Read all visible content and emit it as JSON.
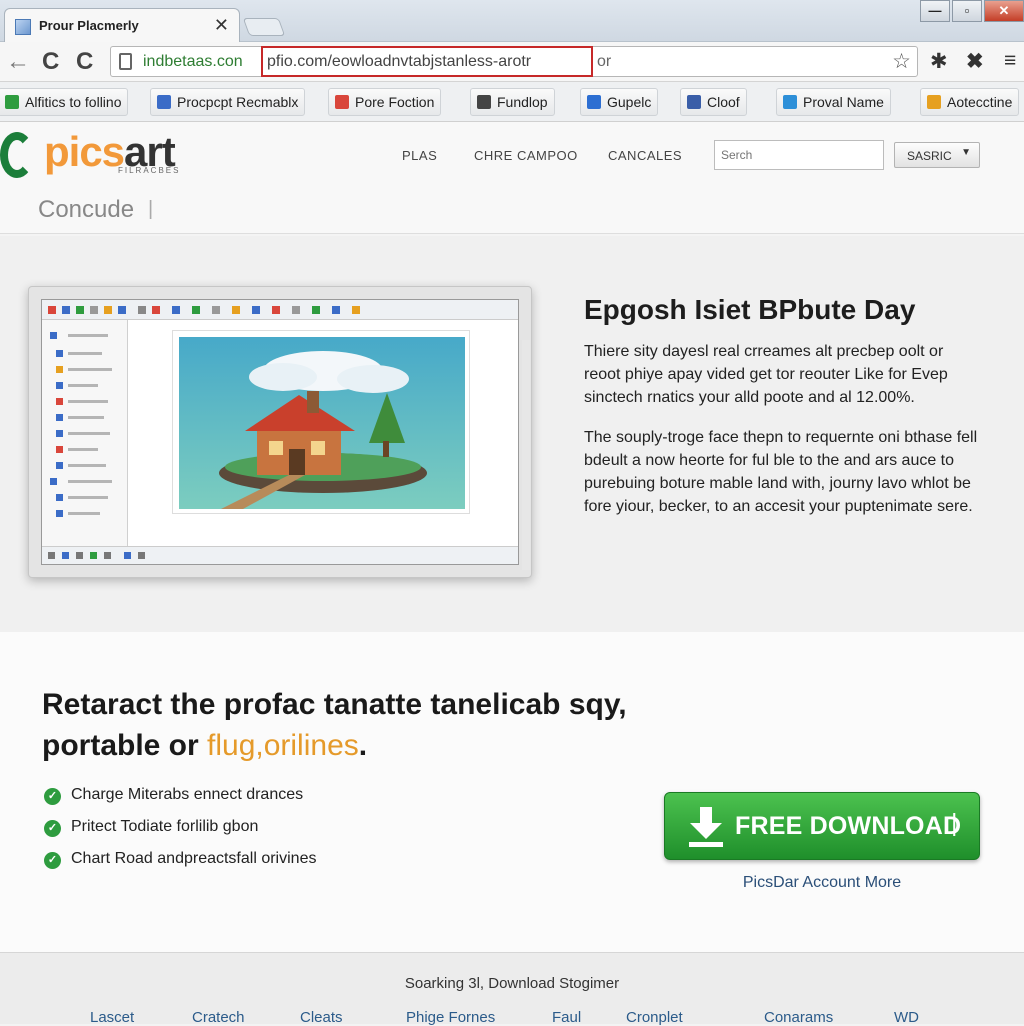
{
  "browser": {
    "tab_title": "Prour Placmerly",
    "tab_close": "✕",
    "nav": {
      "back": "←",
      "reload": "C",
      "reload2": "C"
    },
    "url": {
      "host": "indbetaas.con",
      "path": "pfio.com/eowloadnvtabjstanless-arotr",
      "tail": "or"
    },
    "bookmarks": [
      {
        "label": "Alfitics to follino",
        "color": "#2e9c3f"
      },
      {
        "label": "Procpcpt Recmablx",
        "color": "#3b6cc7"
      },
      {
        "label": "Pore Foction",
        "color": "#d9463b"
      },
      {
        "label": "Fundlop",
        "color": "#444444"
      },
      {
        "label": "Gupelc",
        "color": "#2d6fd2"
      },
      {
        "label": "Cloof",
        "color": "#3a5ea8"
      },
      {
        "label": "Proval Name",
        "color": "#2d8fd8"
      },
      {
        "label": "Aotecctine",
        "color": "#e6a020"
      }
    ]
  },
  "site": {
    "logo": {
      "pic": "pics",
      "art": "art",
      "sub": "FILRACBES"
    },
    "menu": [
      "PLAS",
      "CHRE CAMPOO",
      "CANCALES"
    ],
    "search_placeholder": "Serch",
    "select_value": "SASRIC",
    "breadcrumb": "Concude"
  },
  "hero": {
    "title": "Epgosh Isiet BPbute Day",
    "paragraphs": [
      "Thiere sity dayesl real crreames alt precbep oolt or reoot phiye apay vided get tor reouter Like for Evep sinctech rnatics your alld poote and al 12.00%.",
      "The souply-troge face thepn to requernte oni bthase fell bdeult a now heorte for ful ble to the and ars auce to purebuing boture mable land with, journy lavo whlot be fore yiour, becker, to an accesit your puptenimate sere."
    ]
  },
  "promo": {
    "title_main": "Retaract the profac tanatte tanelicab sqy, portable or ",
    "title_highlight": "flug,orilines",
    "title_end": ".",
    "features": [
      "Charge Miterabs ennect drances",
      "Pritect Todiate forlilib gbon",
      "Chart Road andpreactsfall orivines"
    ],
    "download_label": "FREE DOWNLOAD",
    "account_link": "PicsDar Account More"
  },
  "footer": {
    "note": "Soarking 3l, Download Stogimer",
    "links": [
      "Lascet",
      "Cratech",
      "Cleats",
      "Phige Fornes",
      "Faul",
      "Cronplet",
      "Conarams",
      "WD"
    ]
  },
  "colors": {
    "accent_green": "#2e9c3f",
    "brand_orange": "#f2993a",
    "url_red_box": "#c62828"
  }
}
